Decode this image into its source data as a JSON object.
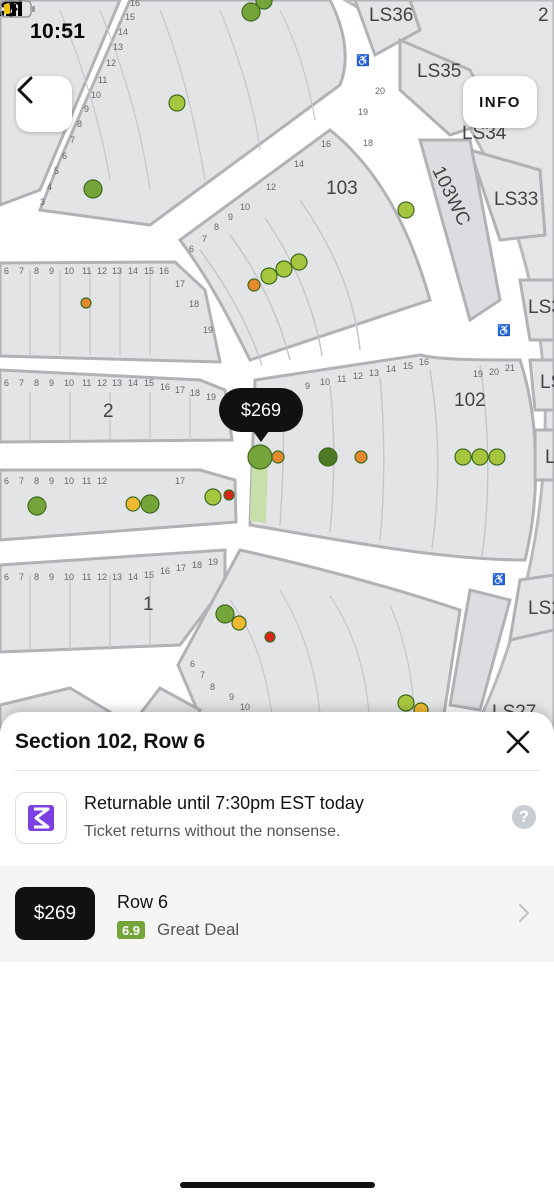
{
  "status_bar": {
    "time": "10:51"
  },
  "map": {
    "sections": [
      {
        "label": "LS36"
      },
      {
        "label": "2"
      },
      {
        "label": "LS35"
      },
      {
        "label": "LS34"
      },
      {
        "label": "103WC"
      },
      {
        "label": "LS33"
      },
      {
        "label": "103"
      },
      {
        "label": "102"
      },
      {
        "label": "2"
      },
      {
        "label": "1"
      },
      {
        "label": "LS3"
      },
      {
        "label": "LS"
      },
      {
        "label": "L"
      },
      {
        "label": "LS2"
      },
      {
        "label": "LS27"
      }
    ],
    "row_numbers": [
      "1",
      "2",
      "3",
      "4",
      "5",
      "6",
      "7",
      "8",
      "9",
      "10",
      "11",
      "12",
      "13",
      "14",
      "15",
      "16",
      "17",
      "18",
      "19",
      "20",
      "21"
    ],
    "legend_colors": {
      "green": "#74a43a",
      "lightgreen": "#a7c63f",
      "darkgreen": "#4f7a25",
      "orange": "#e6882e",
      "yellow": "#f0b932",
      "red": "#d9261c"
    }
  },
  "selected_price": "$269",
  "info_button": "INFO",
  "sheet": {
    "title": "Section 102, Row 6",
    "returnable_title": "Returnable until 7:30pm EST today",
    "returnable_subtitle": "Ticket returns without the nonsense.",
    "help": "?",
    "listing": {
      "price": "$269",
      "row": "Row 6",
      "score": "6.9",
      "deal": "Great Deal"
    }
  }
}
